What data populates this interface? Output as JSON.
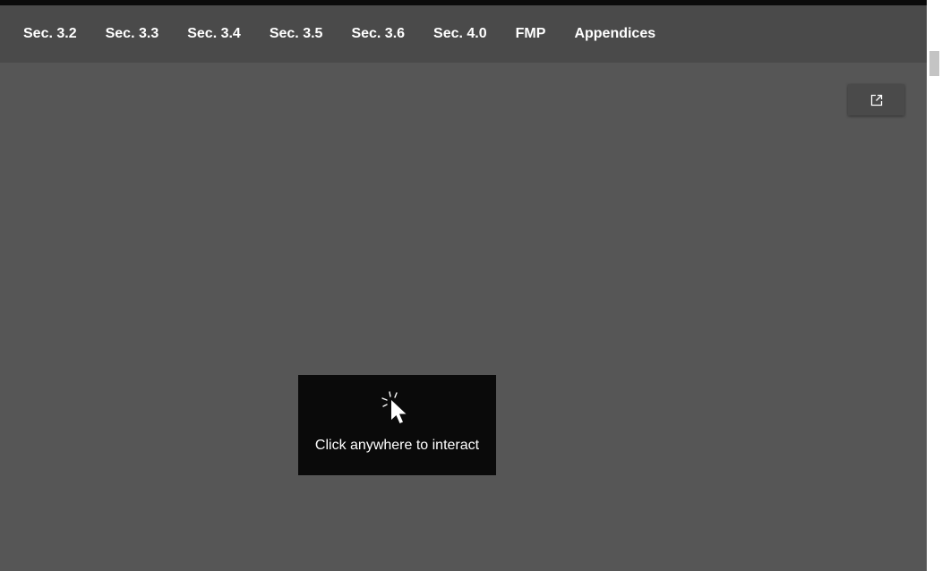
{
  "nav": {
    "items": [
      {
        "label": "Sec. 3.2"
      },
      {
        "label": "Sec. 3.3"
      },
      {
        "label": "Sec. 3.4"
      },
      {
        "label": "Sec. 3.5"
      },
      {
        "label": "Sec. 3.6"
      },
      {
        "label": "Sec. 4.0"
      },
      {
        "label": "FMP"
      },
      {
        "label": "Appendices"
      }
    ]
  },
  "toolbar": {
    "open_new_icon": "external-link-icon"
  },
  "overlay": {
    "icon": "click-cursor-icon",
    "text": "Click anywhere to interact"
  },
  "colors": {
    "background": "#565656",
    "navbar": "#4a4a4a",
    "top_strip": "#0b0b0b",
    "overlay": "#0a0a0a",
    "text": "#ffffff"
  }
}
